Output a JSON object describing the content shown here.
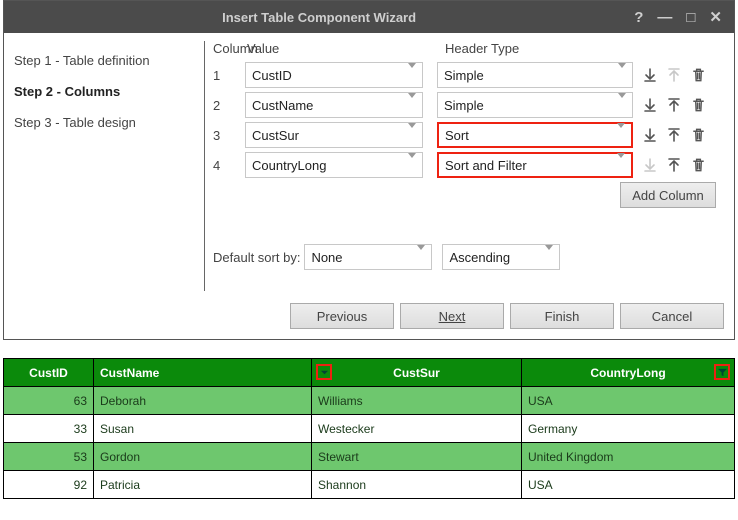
{
  "titlebar": {
    "title": "Insert Table Component Wizard",
    "help": "?",
    "min": "—",
    "max": "□",
    "close": "✕"
  },
  "sidebar": {
    "steps": [
      {
        "label": "Step 1 - Table definition",
        "active": false
      },
      {
        "label": "Step 2 - Columns",
        "active": true
      },
      {
        "label": "Step 3 - Table design",
        "active": false
      }
    ]
  },
  "cols": {
    "column_hdr": "Column",
    "value_hdr": "Value",
    "htype_hdr": "Header Type",
    "rows": [
      {
        "n": "1",
        "value": "CustID",
        "htype": "Simple",
        "hl": false,
        "up": false,
        "down": true
      },
      {
        "n": "2",
        "value": "CustName",
        "htype": "Simple",
        "hl": false,
        "up": true,
        "down": true
      },
      {
        "n": "3",
        "value": "CustSur",
        "htype": "Sort",
        "hl": true,
        "up": true,
        "down": true
      },
      {
        "n": "4",
        "value": "CountryLong",
        "htype": "Sort and Filter",
        "hl": true,
        "up": true,
        "down": false
      }
    ],
    "add_label": "Add Column"
  },
  "sort": {
    "label": "Default sort by:",
    "value": "None",
    "dir": "Ascending"
  },
  "buttons": {
    "prev": "Previous",
    "next": "Next",
    "finish": "Finish",
    "cancel": "Cancel"
  },
  "preview": {
    "headers": {
      "c1": "CustID",
      "c2": "CustName",
      "c3": "CustSur",
      "c4": "CountryLong"
    },
    "rows": [
      {
        "id": "63",
        "name": "Deborah",
        "sur": "Williams",
        "country": "USA"
      },
      {
        "id": "33",
        "name": "Susan",
        "sur": "Westecker",
        "country": "Germany"
      },
      {
        "id": "53",
        "name": "Gordon",
        "sur": "Stewart",
        "country": "United Kingdom"
      },
      {
        "id": "92",
        "name": "Patricia",
        "sur": "Shannon",
        "country": "USA"
      }
    ]
  }
}
